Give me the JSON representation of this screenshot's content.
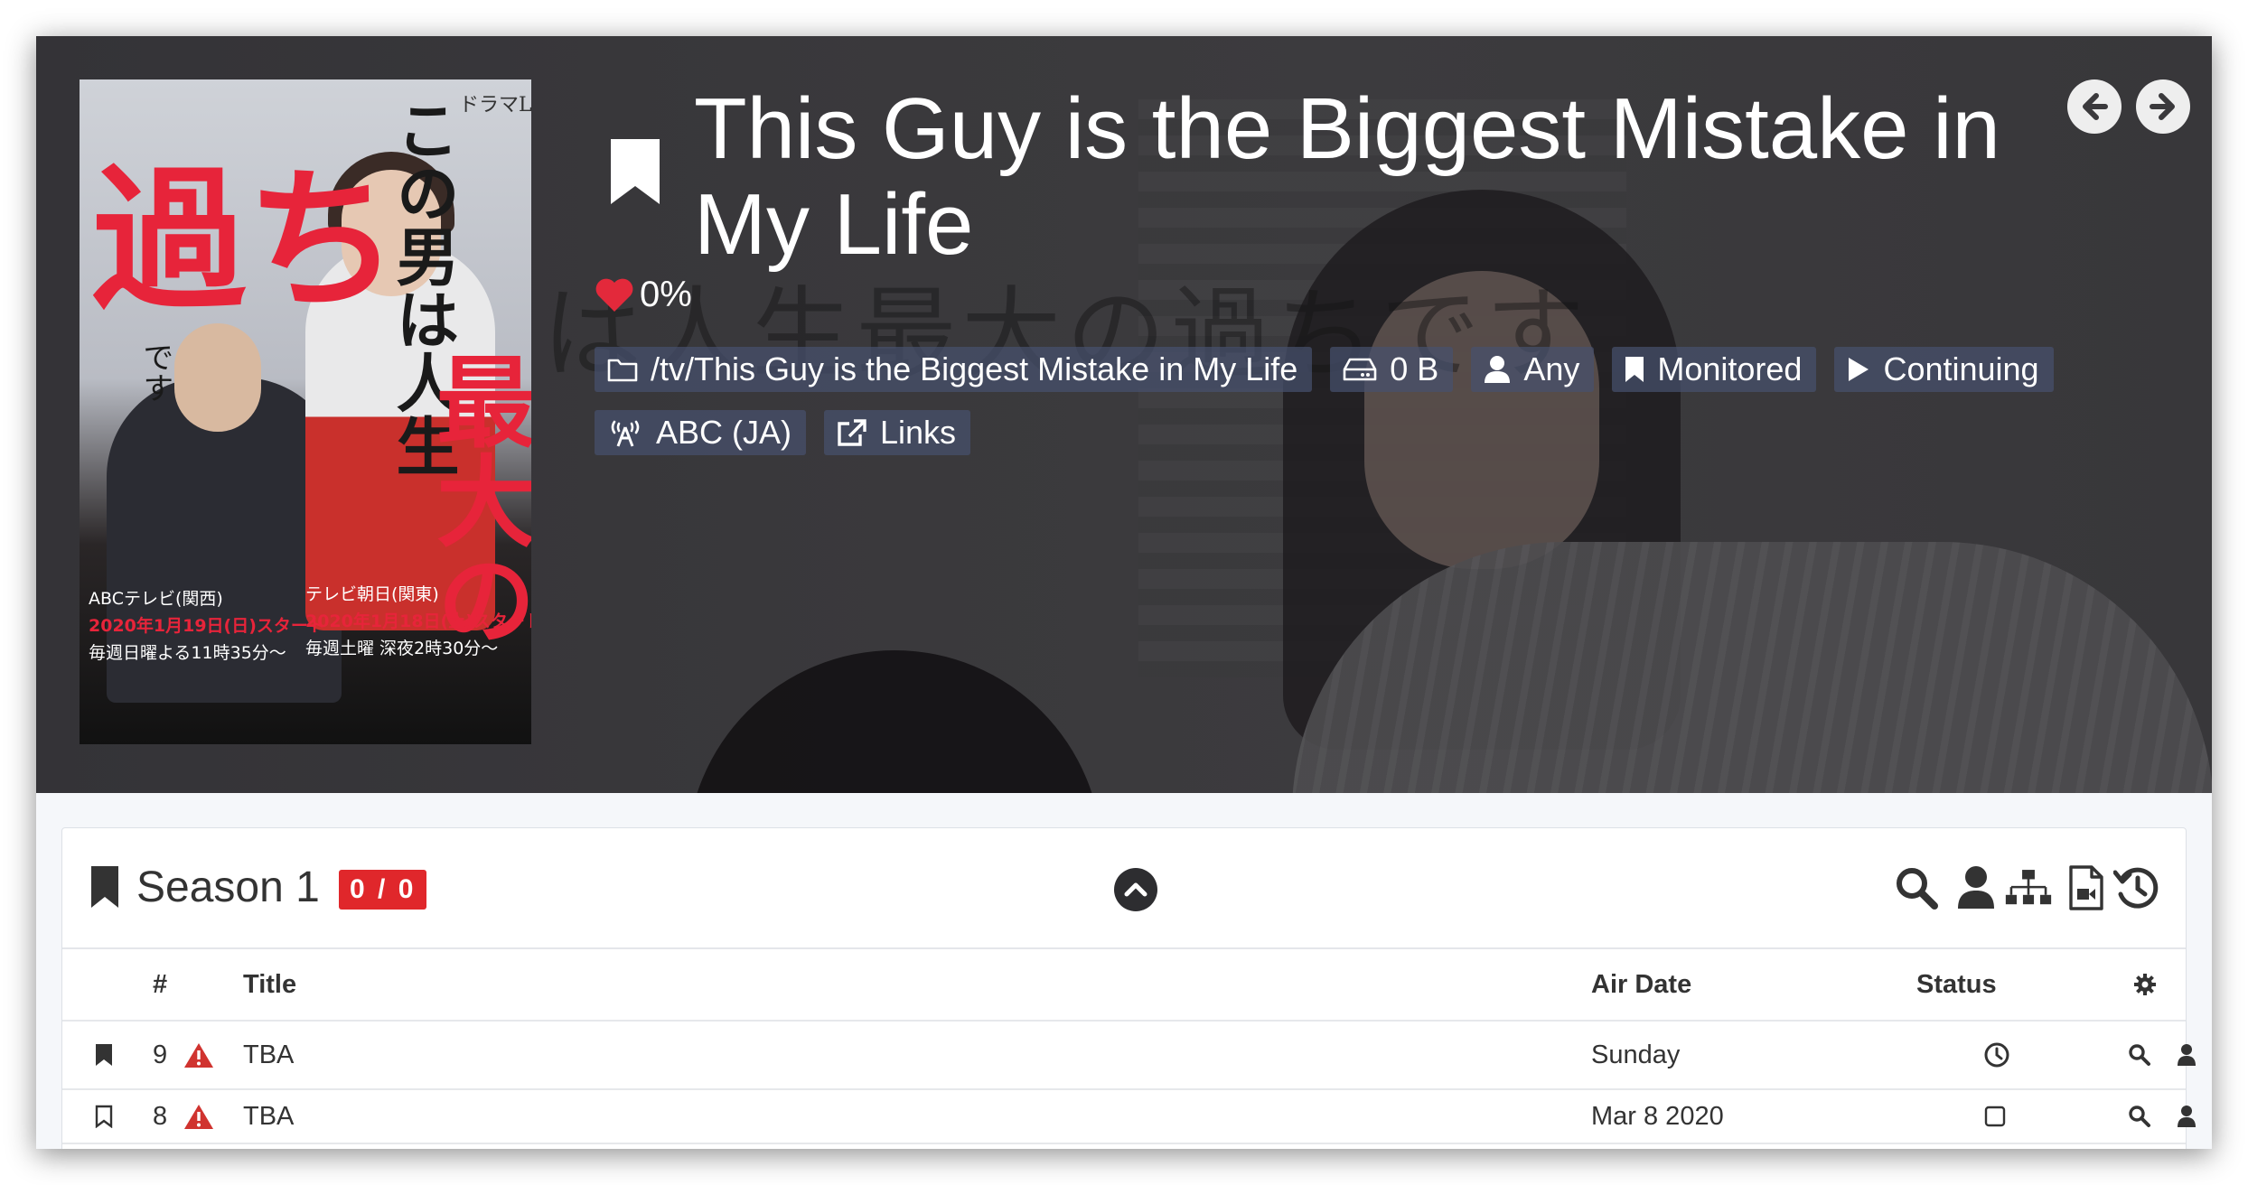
{
  "series": {
    "title": "This Guy is the Biggest Mistake in My Life",
    "rating": "0%",
    "poster": {
      "brand_label": "ドラマL",
      "title_big": "過ち",
      "title_col": "この男は人生",
      "title_red": "最大の",
      "small_left": "です",
      "schedule_left_line1": "ABCテレビ(関西)",
      "schedule_left_line2": "2020年1月19日(日)スタート",
      "schedule_left_line3": "毎週日曜よる11時35分〜",
      "schedule_right_line1": "テレビ朝日(関東)",
      "schedule_right_line2": "2020年1月18日(土)スタート",
      "schedule_right_line3": "毎週土曜 深夜2時30分〜"
    },
    "background_text": "は人生最大の過ちです"
  },
  "tags": {
    "path": "/tv/This Guy is the Biggest Mistake in My Life",
    "size": "0 B",
    "quality": "Any",
    "monitored": "Monitored",
    "status": "Continuing",
    "network": "ABC (JA)",
    "links": "Links"
  },
  "season": {
    "title": "Season 1",
    "badge": "0 / 0",
    "columns": {
      "number": "#",
      "title": "Title",
      "air_date": "Air Date",
      "status": "Status"
    },
    "episodes": [
      {
        "number": "9",
        "title": "TBA",
        "air_date": "Sunday"
      },
      {
        "number": "8",
        "title": "TBA",
        "air_date": "Mar 8 2020"
      }
    ]
  },
  "colors": {
    "header_bg": "#3a393c",
    "tag_bg": "#46506e",
    "badge_red": "#e0272b",
    "heart_red": "#e3293b",
    "warning_red": "#d0332f"
  },
  "icons": {
    "bookmark": "bookmark-icon",
    "prev": "arrow-left-circle-icon",
    "next": "arrow-right-circle-icon",
    "heart": "heart-icon",
    "folder": "folder-icon",
    "drive": "hard-drive-icon",
    "user": "user-icon",
    "play": "play-icon",
    "tower": "broadcast-tower-icon",
    "external": "external-link-icon",
    "collapse": "chevron-up-circle-icon",
    "search": "search-icon",
    "manual": "user-icon",
    "organize": "sitemap-icon",
    "file": "file-video-icon",
    "history": "history-icon",
    "gear": "gear-icon",
    "warning": "warning-icon",
    "clock": "clock-icon"
  }
}
